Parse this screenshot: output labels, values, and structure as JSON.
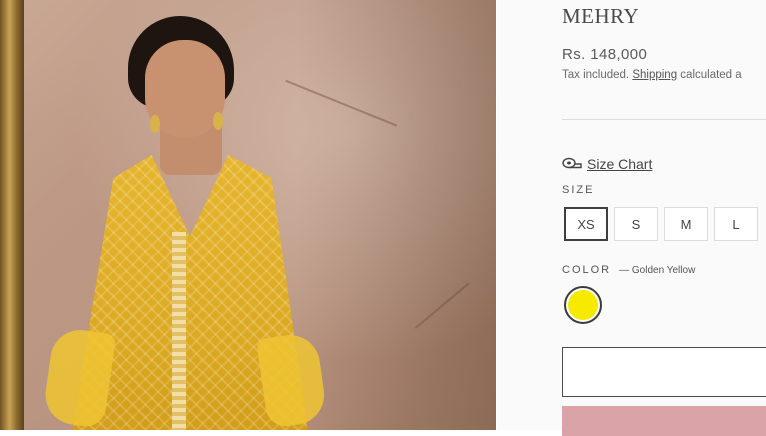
{
  "product": {
    "title": "MEHRY",
    "price": "Rs. 148,000",
    "tax_prefix": "Tax included.",
    "shipping_link": "Shipping",
    "tax_suffix": "calculated a"
  },
  "size_chart": {
    "label": "Size Chart",
    "icon": "ruler-tape-icon"
  },
  "size": {
    "label": "SIZE",
    "options": [
      "XS",
      "S",
      "M",
      "L"
    ],
    "selected": "XS"
  },
  "color": {
    "label": "COLOR",
    "value": "— Golden Yellow",
    "swatch_hex": "#f5ea00"
  },
  "colors": {
    "add_button": "#d9a3a8"
  }
}
